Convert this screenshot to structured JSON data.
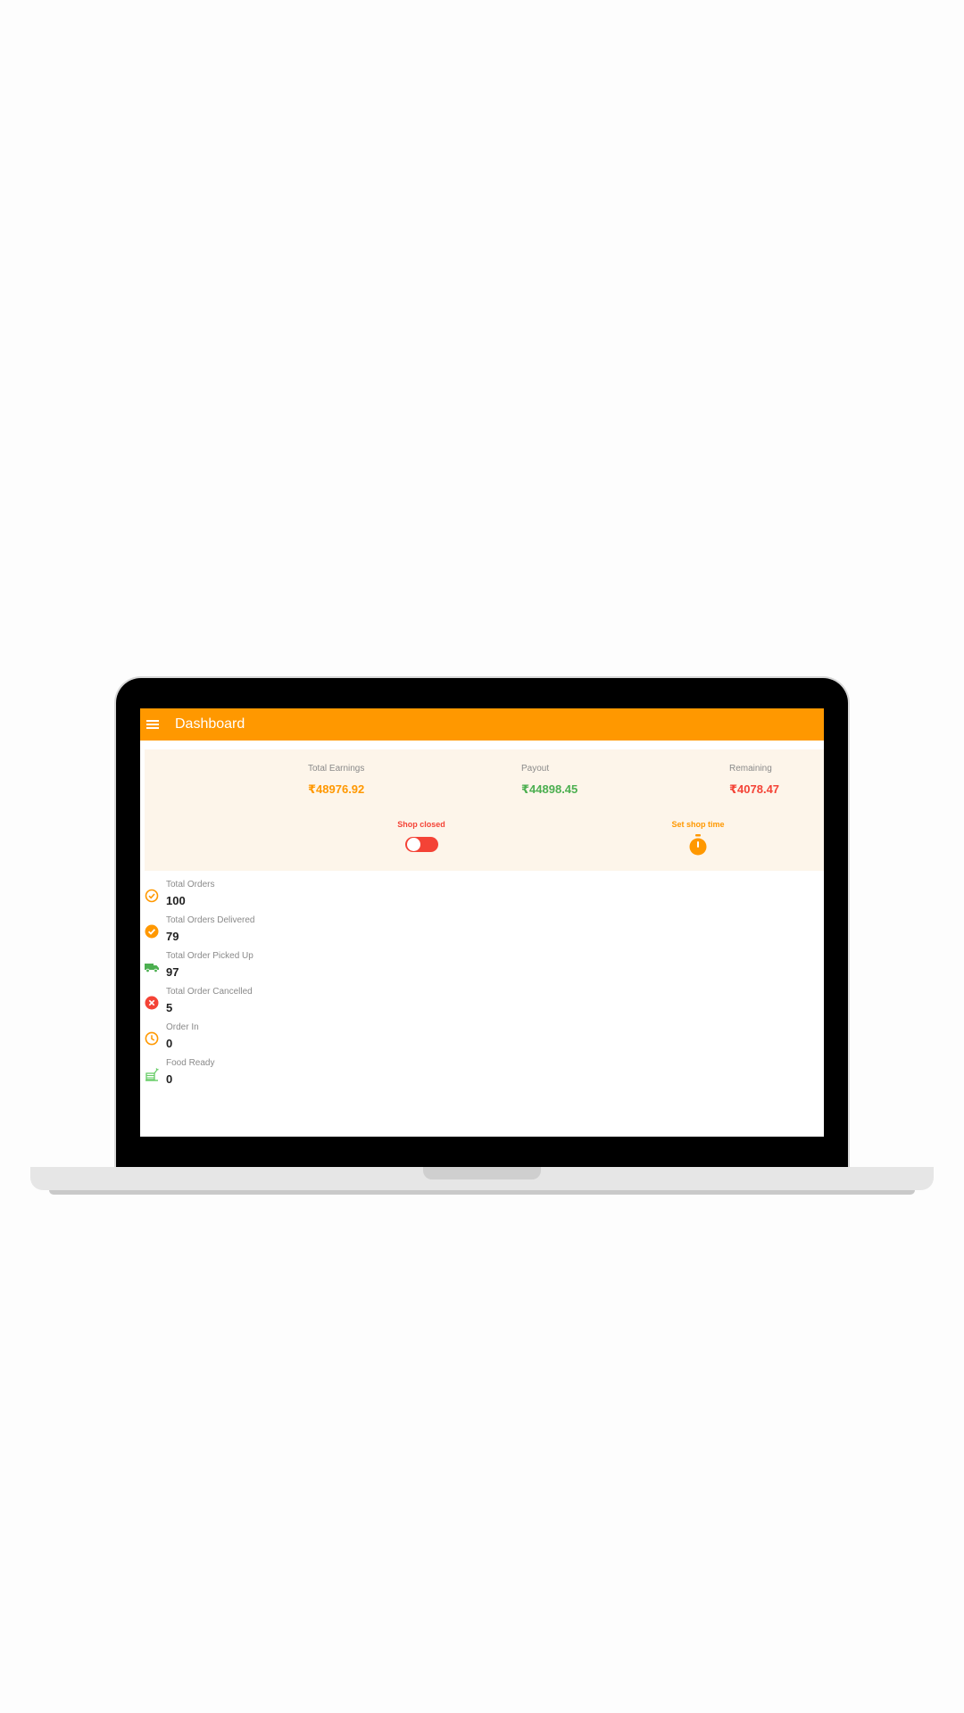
{
  "appbar": {
    "title": "Dashboard",
    "menu_icon": "menu-icon",
    "color": "#ff9800"
  },
  "summary": {
    "total_earnings": {
      "label": "Total Earnings",
      "value": "₹48976.92",
      "color": "#ff9800"
    },
    "payout": {
      "label": "Payout",
      "value": "₹44898.45",
      "color": "#4caf50"
    },
    "remaining": {
      "label": "Remaining",
      "value": "₹4078.47",
      "color": "#f44336"
    }
  },
  "shop": {
    "status_label": "Shop closed",
    "toggle_on": false,
    "set_time_label": "Set shop time",
    "set_time_icon": "stopwatch-icon"
  },
  "orders": [
    {
      "label": "Total Orders",
      "value": "100",
      "icon": "check-circle-outline-icon"
    },
    {
      "label": "Total Orders Delivered",
      "value": "79",
      "icon": "check-circle-filled-icon"
    },
    {
      "label": "Total Order Picked Up",
      "value": "97",
      "icon": "truck-icon"
    },
    {
      "label": "Total Order Cancelled",
      "value": "5",
      "icon": "cancel-circle-icon"
    },
    {
      "label": "Order In",
      "value": "0",
      "icon": "clock-icon"
    },
    {
      "label": "Food Ready",
      "value": "0",
      "icon": "food-icon"
    }
  ]
}
